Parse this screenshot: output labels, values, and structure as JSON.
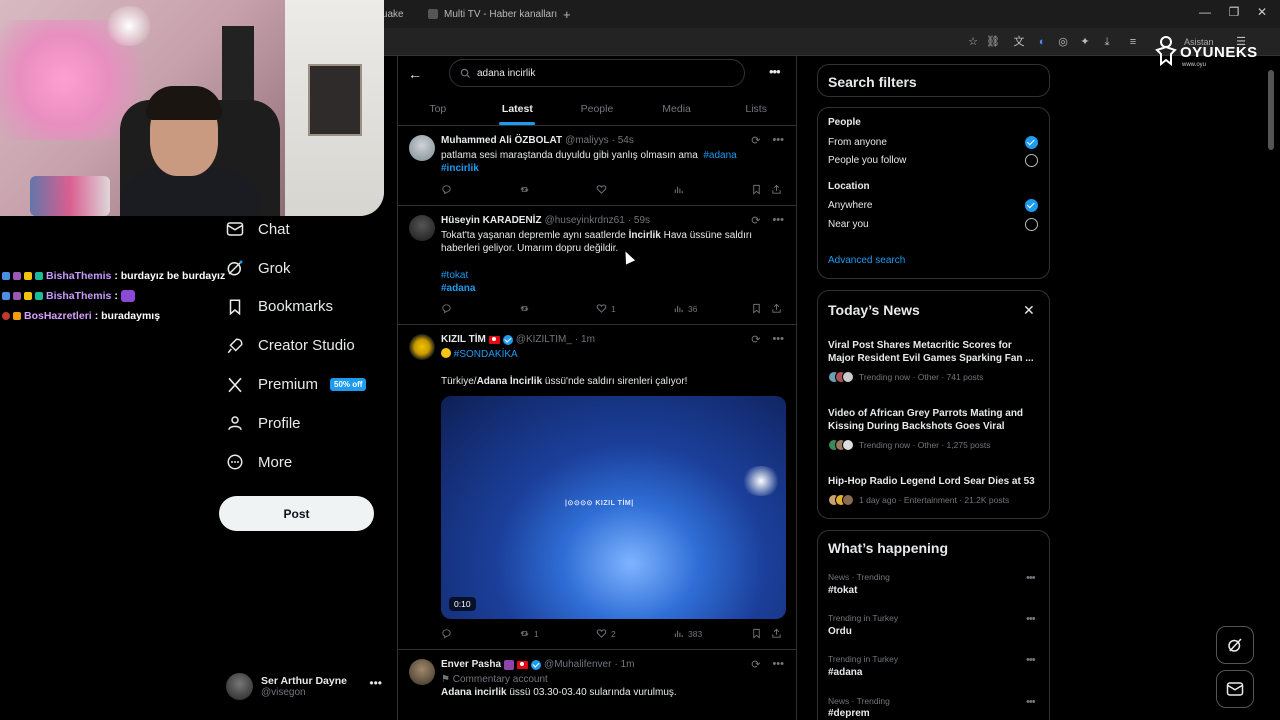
{
  "browser": {
    "tabs": [
      {
        "title": "thquake"
      },
      {
        "title": "Multi TV - Haber kanalları"
      }
    ],
    "new_tab": "+",
    "assistant_label": "Asistan"
  },
  "overlay": {
    "logo_text": "OYUNEKS",
    "logo_sub": "www.oyu",
    "chat": [
      {
        "user": "BishaThemis",
        "message": ": burdayız be burdayız"
      },
      {
        "user": "BishaThemis",
        "message": ":"
      },
      {
        "user": "BosHazretleri",
        "message": ": buradaymış"
      }
    ]
  },
  "nav": {
    "items": [
      {
        "label": "Chat",
        "icon": "envelope-icon"
      },
      {
        "label": "Grok",
        "icon": "grok-icon"
      },
      {
        "label": "Bookmarks",
        "icon": "bookmark-icon"
      },
      {
        "label": "Creator Studio",
        "icon": "rocket-icon"
      },
      {
        "label": "Premium",
        "icon": "x-logo-icon",
        "badge": "50% off"
      },
      {
        "label": "Profile",
        "icon": "person-icon"
      },
      {
        "label": "More",
        "icon": "more-circle-icon"
      }
    ],
    "post_label": "Post",
    "account": {
      "name": "Ser Arthur Dayne",
      "handle": "@visegon"
    }
  },
  "search": {
    "query": "adana incirlik",
    "tabs": [
      "Top",
      "Latest",
      "People",
      "Media",
      "Lists"
    ],
    "active_tab": "Latest"
  },
  "tweets": [
    {
      "name": "Muhammed Ali ÖZBOLAT",
      "handle": "@maliyys",
      "time": "· 54s",
      "text": "patlama sesi maraştanda duyuldu gibi yanlış olmasın ama",
      "hashtags": [
        "#adana",
        "#incirlik"
      ],
      "replies": "",
      "reposts": "",
      "likes": "",
      "views": ""
    },
    {
      "name": "Hüseyin KARADENİZ",
      "handle": "@huseyinkrdnz61",
      "time": "· 59s",
      "text_a": "Tokat'ta yaşanan depremle aynı saatlerde",
      "text_bold": "İncirlik",
      "text_b": "Hava üssüne saldırı haberleri geliyor. Umarım dopru değildir.",
      "hashtags": [
        "#tokat",
        "#adana"
      ],
      "replies": "",
      "reposts": "",
      "likes": "1",
      "views": "36"
    },
    {
      "name": "KIZIL TİM",
      "handle": "@KIZILTIM_",
      "time": "· 1m",
      "hashtag_line": "#SONDAKİKA",
      "text_a": "Türkiye/",
      "text_bold": "Adana İncirlik",
      "text_b": "üssü'nde saldırı sirenleri çalıyor!",
      "video_watermark": "|⊙⊙⊙⊙ KIZIL TİM|",
      "video_duration": "0:10",
      "replies": "",
      "reposts": "1",
      "likes": "2",
      "views": "383"
    },
    {
      "name": "Enver Pasha",
      "handle": "@Muhalifenver",
      "time": "· 1m",
      "label": "Commentary account",
      "text_bold": "Adana incirlik",
      "text_b": "üssü 03.30-03.40 sularında vurulmuş."
    }
  ],
  "filters": {
    "title": "Search filters",
    "people_label": "People",
    "people_options": [
      {
        "label": "From anyone",
        "checked": true
      },
      {
        "label": "People you follow",
        "checked": false
      }
    ],
    "location_label": "Location",
    "location_options": [
      {
        "label": "Anywhere",
        "checked": true
      },
      {
        "label": "Near you",
        "checked": false
      }
    ],
    "advanced": "Advanced search"
  },
  "news": {
    "title": "Today’s News",
    "items": [
      {
        "title": "Viral Post Shares Metacritic Scores for Major Resident Evil Games Sparking Fan ...",
        "meta": "Trending now · Other · 741 posts"
      },
      {
        "title": "Video of African Grey Parrots Mating and Kissing During Backshots Goes Viral",
        "meta": "Trending now · Other · 1,275 posts"
      },
      {
        "title": "Hip-Hop Radio Legend Lord Sear Dies at 53",
        "meta": "1 day ago · Entertainment · 21.2K posts"
      }
    ]
  },
  "happening": {
    "title": "What’s happening",
    "items": [
      {
        "category": "News · Trending",
        "name": "#tokat"
      },
      {
        "category": "Trending in Turkey",
        "name": "Ordu"
      },
      {
        "category": "Trending in Turkey",
        "name": "#adana"
      },
      {
        "category": "News · Trending",
        "name": "#deprem"
      }
    ]
  },
  "colors": {
    "accent": "#1d9bf0",
    "background": "#000000",
    "border": "#2f3336",
    "muted": "#71767b"
  }
}
